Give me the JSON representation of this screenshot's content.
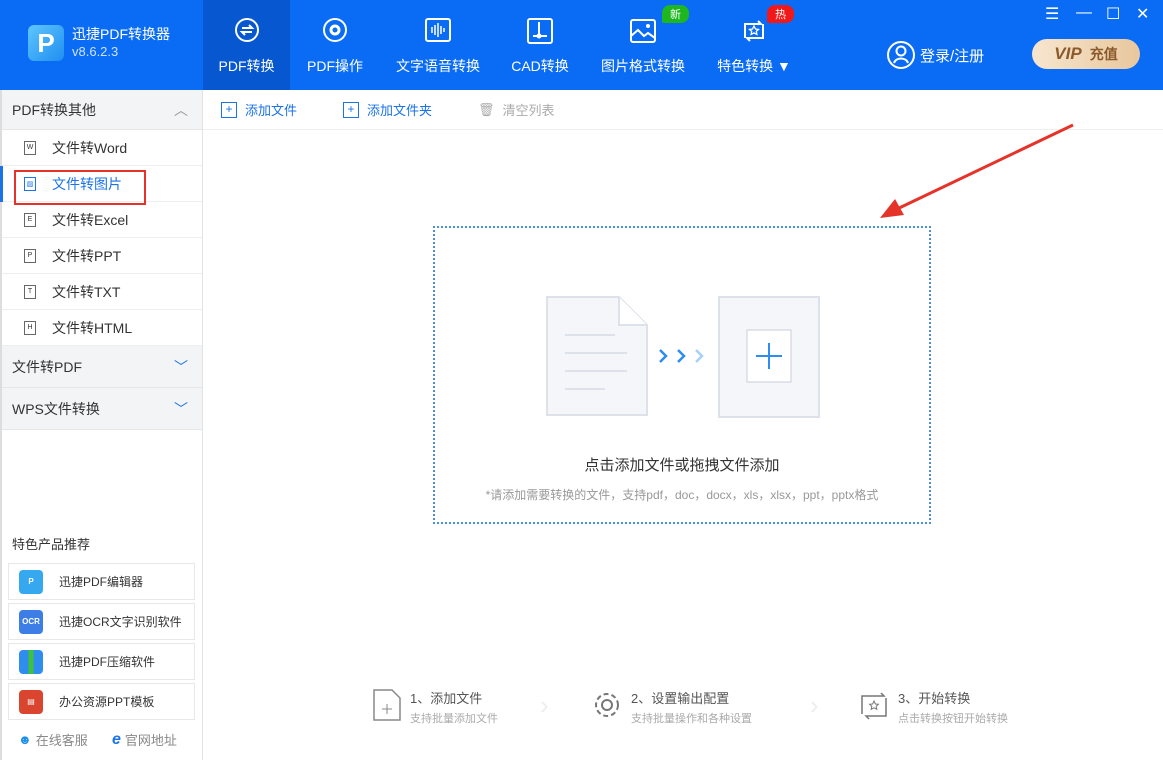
{
  "app": {
    "name": "迅捷PDF转换器",
    "version": "v8.6.2.3"
  },
  "nav": [
    {
      "label": "PDF转换"
    },
    {
      "label": "PDF操作"
    },
    {
      "label": "文字语音转换"
    },
    {
      "label": "CAD转换"
    },
    {
      "label": "图片格式转换",
      "badge": "新"
    },
    {
      "label": "特色转换",
      "badge": "热"
    }
  ],
  "header": {
    "login": "登录/注册",
    "vip": "VIP",
    "vip_suffix": "充值"
  },
  "sidebar": {
    "section1": "PDF转换其他",
    "items": [
      {
        "label": "文件转Word",
        "icon": "W"
      },
      {
        "label": "文件转图片",
        "icon": "img"
      },
      {
        "label": "文件转Excel",
        "icon": "E"
      },
      {
        "label": "文件转PPT",
        "icon": "P"
      },
      {
        "label": "文件转TXT",
        "icon": "T"
      },
      {
        "label": "文件转HTML",
        "icon": "H"
      }
    ],
    "section2": "文件转PDF",
    "section3": "WPS文件转换",
    "rec_title": "特色产品推荐",
    "products": [
      {
        "label": "迅捷PDF编辑器",
        "icon": "PDF"
      },
      {
        "label": "迅捷OCR文字识别软件",
        "icon": "OCR"
      },
      {
        "label": "迅捷PDF压缩软件",
        "icon": "ZIP"
      },
      {
        "label": "办公资源PPT模板",
        "icon": "PPT"
      }
    ],
    "service": "在线客服",
    "website": "官网地址"
  },
  "toolbar": {
    "add_file": "添加文件",
    "add_folder": "添加文件夹",
    "clear": "清空列表"
  },
  "drop": {
    "title": "点击添加文件或拖拽文件添加",
    "hint": "*请添加需要转换的文件，支持pdf，doc，docx，xls，xlsx，ppt，pptx格式"
  },
  "steps": [
    {
      "title": "1、添加文件",
      "desc": "支持批量添加文件"
    },
    {
      "title": "2、设置输出配置",
      "desc": "支持批量操作和各种设置"
    },
    {
      "title": "3、开始转换",
      "desc": "点击转换按钮开始转换"
    }
  ],
  "colors": {
    "brand": "#0a6cf5",
    "accent": "#1a73e8",
    "highlight": "#e5332a"
  }
}
